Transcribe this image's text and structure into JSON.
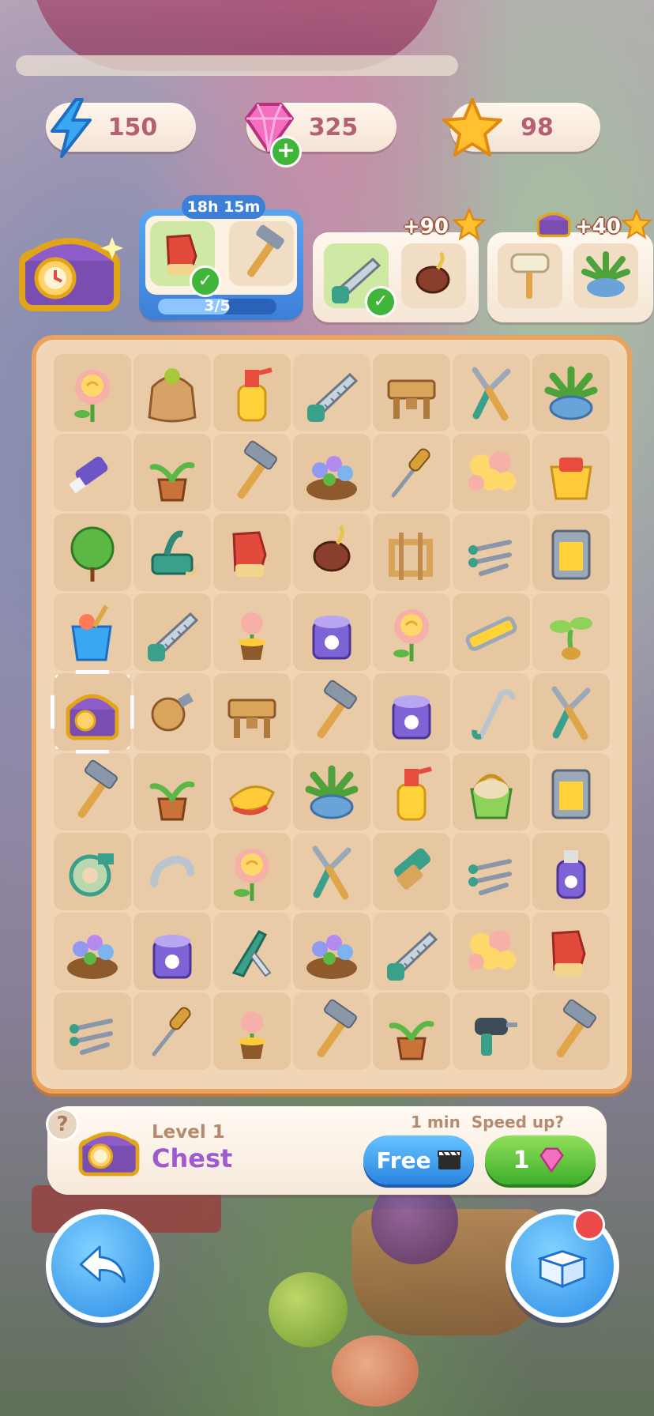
{
  "resources": {
    "energy": "150",
    "gems": "325",
    "stars": "98"
  },
  "orders": {
    "active": {
      "timer": "18h 15m",
      "progress_text": "3/5",
      "progress": 0.6,
      "items": [
        "gloves-icon",
        "hammer-icon"
      ]
    },
    "order2": {
      "reward": "+90",
      "items": [
        "saw-icon",
        "seed-icon"
      ]
    },
    "order3": {
      "reward": "+40",
      "items": [
        "paint-roller-icon",
        "potted-plant-icon"
      ]
    }
  },
  "board": {
    "rows": [
      [
        "rose-icon",
        "seed-sack-icon",
        "spray-bottle-icon",
        "saw-icon",
        "workbench-icon",
        "pruning-shears-icon",
        "potted-plant-icon"
      ],
      [
        "glue-tube-icon",
        "sprout-pot-icon",
        "hammer-icon",
        "flower-bed-icon",
        "screwdriver-icon",
        "rose-bouquet-icon",
        "bucket-icon"
      ],
      [
        "shrub-icon",
        "plane-tool-icon",
        "gloves-icon",
        "seed-icon",
        "wood-frame-icon",
        "nails-icon",
        "cabinet-icon"
      ],
      [
        "sand-bucket-icon",
        "saw-icon",
        "flower-pot-icon",
        "paint-can-icon",
        "rose-icon",
        "level-tool-icon",
        "sprout-icon"
      ],
      [
        "chest-icon",
        "wood-knob-icon",
        "workbench-icon",
        "hammer-icon",
        "paint-can-icon",
        "crowbar-icon",
        "pruning-shears-icon"
      ],
      [
        "hammer-icon",
        "sprout-pot-icon",
        "brush-icon",
        "potted-plant-icon",
        "spray-bottle-icon",
        "basket-icon",
        "cabinet-icon"
      ],
      [
        "tape-icon",
        "handle-icon",
        "rose-icon",
        "pruning-shears-icon",
        "stapler-icon",
        "nails-icon",
        "spray-paint-icon"
      ],
      [
        "flower-bed-icon",
        "paint-can-icon",
        "pocket-knife-icon",
        "flower-bed-icon",
        "saw-icon",
        "rose-bouquet-icon",
        "gloves-icon"
      ],
      [
        "nails-icon",
        "screwdriver-icon",
        "flower-pot-icon",
        "hammer-icon",
        "sprout-pot-icon",
        "drill-icon",
        "hammer-icon"
      ]
    ],
    "selected": [
      4,
      0
    ]
  },
  "info": {
    "help": "?",
    "level": "Level 1",
    "name": "Chest",
    "speed_hint": "1 min  Speed up?",
    "free_label": "Free",
    "gem_cost": "1"
  },
  "colors": {
    "accent_blue": "#3c7fd8",
    "accent_green": "#3fae2c",
    "accent_purple": "#a05ad0",
    "board_border": "#e9a35e"
  }
}
